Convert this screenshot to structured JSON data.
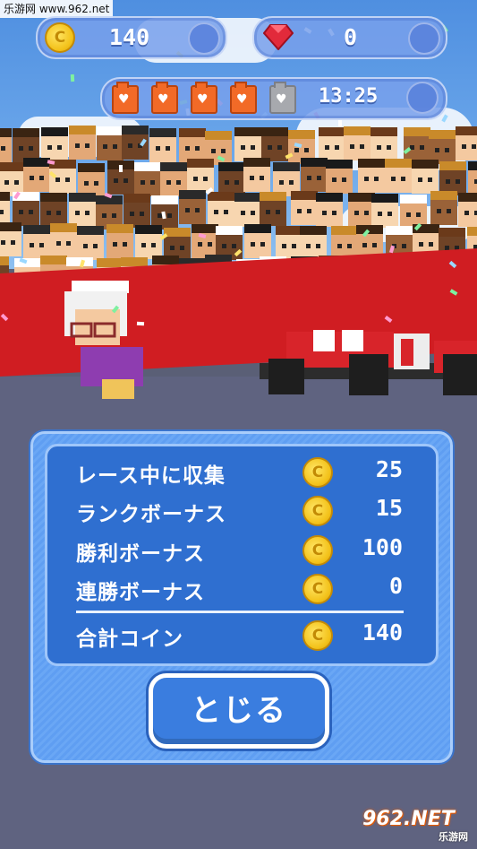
{
  "watermark_top": "乐游网 www.962.net",
  "watermark_bottom": {
    "brand": "962.NET",
    "sub": "乐游网"
  },
  "hud": {
    "coins": "140",
    "gems": "0",
    "fuel_full": 4,
    "fuel_total": 5,
    "timer": "13:25",
    "coin_symbol": "C"
  },
  "results": {
    "rows": [
      {
        "label": "レース中に収集",
        "amount": "25"
      },
      {
        "label": "ランクボーナス",
        "amount": "15"
      },
      {
        "label": "勝利ボーナス",
        "amount": "100"
      },
      {
        "label": "連勝ボーナス",
        "amount": "0"
      }
    ],
    "total": {
      "label": "合計コイン",
      "amount": "140"
    }
  },
  "close_label": "とじる",
  "colors": {
    "panel": "#5f9ef2",
    "inner": "#2f6fd0",
    "coin": "#f3c21a",
    "gem": "#e22a3b",
    "fuel": "#f26a27",
    "wall": "#d01d22"
  }
}
